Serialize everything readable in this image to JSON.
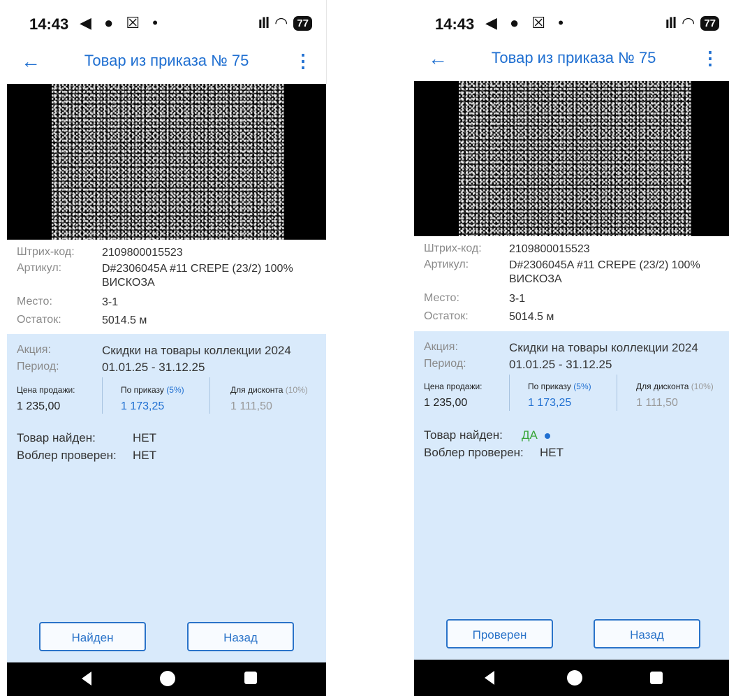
{
  "screens": [
    {
      "status": {
        "time": "14:43",
        "icons": "◀ ● ☒ •",
        "battery": "77"
      },
      "appbar": {
        "back": "←",
        "title": "Товар из приказа № 75",
        "menu": "⋮"
      },
      "info": {
        "barcode_label": "Штрих-код:",
        "barcode": "2109800015523",
        "article_label": "Артикул:",
        "article": "D#2306045A #11 CREPE (23/2) 100% ВИСКОЗА",
        "place_label": "Место:",
        "place": "3-1",
        "stock_label": "Остаток:",
        "stock": "5014.5 м"
      },
      "promo": {
        "action_label": "Акция:",
        "action": "Скидки на товары коллекции 2024",
        "period_label": "Период:",
        "period": "01.01.25 - 31.12.25"
      },
      "prices": {
        "sale_label": "Цена продажи:",
        "sale": "1 235,00",
        "order_label": "По приказу",
        "order_pct": "(5%)",
        "order": "1 173,25",
        "discount_label": "Для дисконта",
        "discount_pct": "(10%)",
        "discount": "1 111,50"
      },
      "status_rows": {
        "found_label": "Товар найден:",
        "found": "НЕТ",
        "found_color": "#333333",
        "wobbler_label": "Воблер проверен:",
        "wobbler": "НЕТ"
      },
      "buttons": {
        "primary": "Найден",
        "back": "Назад"
      }
    },
    {
      "status": {
        "time": "14:43",
        "icons": "◀ ● ☒ •",
        "battery": "77"
      },
      "appbar": {
        "back": "←",
        "title": "Товар из приказа № 75",
        "menu": "⋮"
      },
      "info": {
        "barcode_label": "Штрих-код:",
        "barcode": "2109800015523",
        "article_label": "Артикул:",
        "article": "D#2306045A #11 CREPE (23/2) 100% ВИСКОЗА",
        "place_label": "Место:",
        "place": "3-1",
        "stock_label": "Остаток:",
        "stock": "5014.5 м"
      },
      "promo": {
        "action_label": "Акция:",
        "action": "Скидки на товары коллекции 2024",
        "period_label": "Период:",
        "period": "01.01.25 - 31.12.25"
      },
      "prices": {
        "sale_label": "Цена продажи:",
        "sale": "1 235,00",
        "order_label": "По приказу",
        "order_pct": "(5%)",
        "order": "1 173,25",
        "discount_label": "Для дисконта",
        "discount_pct": "(10%)",
        "discount": "1 111,50"
      },
      "status_rows": {
        "found_label": "Товар найден:",
        "found": "ДА",
        "found_color": "#3aa63a",
        "wobbler_label": "Воблер проверен:",
        "wobbler": "НЕТ"
      },
      "buttons": {
        "primary": "Проверен",
        "back": "Назад"
      }
    }
  ],
  "colors": {
    "accent": "#1f6fd1",
    "panel": "#d9eafb",
    "yes": "#3aa63a"
  }
}
